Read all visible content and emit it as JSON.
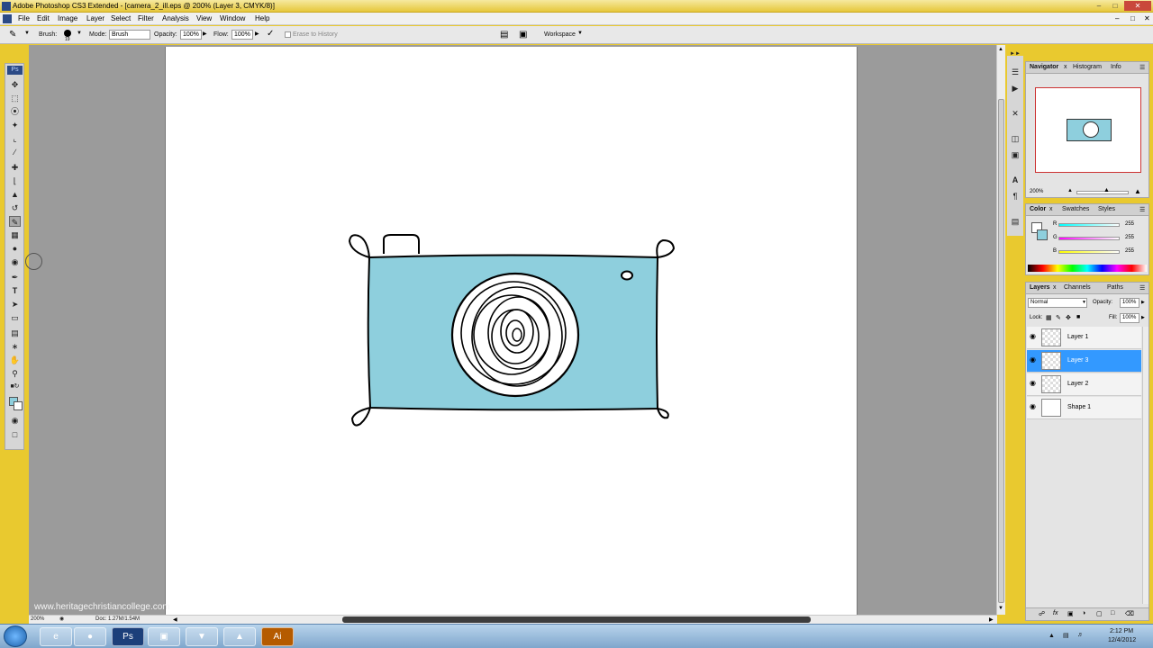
{
  "window": {
    "title": "Adobe Photoshop CS3 Extended - [camera_2_ill.eps @ 200% (Layer 3, CMYK/8)]"
  },
  "menu": [
    "File",
    "Edit",
    "Image",
    "Layer",
    "Select",
    "Filter",
    "Analysis",
    "View",
    "Window",
    "Help"
  ],
  "options": {
    "brush_label": "Brush:",
    "brush_size": "19",
    "mode_label": "Mode:",
    "mode_value": "Brush",
    "opacity_label": "Opacity:",
    "opacity_value": "100%",
    "flow_label": "Flow:",
    "flow_value": "100%",
    "erase_to_history": "Erase to History",
    "workspace_label": "Workspace"
  },
  "tools": {
    "ps_badge": "Ps"
  },
  "status": {
    "zoom": "200%",
    "doc": "Doc: 1.27M/1.54M"
  },
  "watermark": "www.heritagechristiancollege.com",
  "navigator": {
    "tabs": [
      "Navigator",
      "Histogram",
      "Info"
    ],
    "zoom": "200%"
  },
  "color": {
    "tabs": [
      "Color",
      "Swatches",
      "Styles"
    ],
    "channels": [
      {
        "label": "R",
        "value": "255"
      },
      {
        "label": "G",
        "value": "255"
      },
      {
        "label": "B",
        "value": "255"
      }
    ]
  },
  "layers": {
    "tabs": [
      "Layers",
      "Channels",
      "Paths"
    ],
    "blend_mode": "Normal",
    "opacity_label": "Opacity:",
    "opacity_value": "100%",
    "lock_label": "Lock:",
    "fill_label": "Fill:",
    "fill_value": "100%",
    "items": [
      {
        "name": "Layer 1",
        "selected": false
      },
      {
        "name": "Layer 3",
        "selected": true
      },
      {
        "name": "Layer 2",
        "selected": false
      },
      {
        "name": "Shape 1",
        "selected": false
      }
    ]
  },
  "taskbar": {
    "time": "2:12 PM",
    "date": "12/4/2012",
    "apps": [
      "Ps",
      "Ai"
    ]
  },
  "colors": {
    "canvas_fill": "#8ecfdd",
    "selection": "#3399ff",
    "workspace_gray": "#9b9b9b"
  }
}
